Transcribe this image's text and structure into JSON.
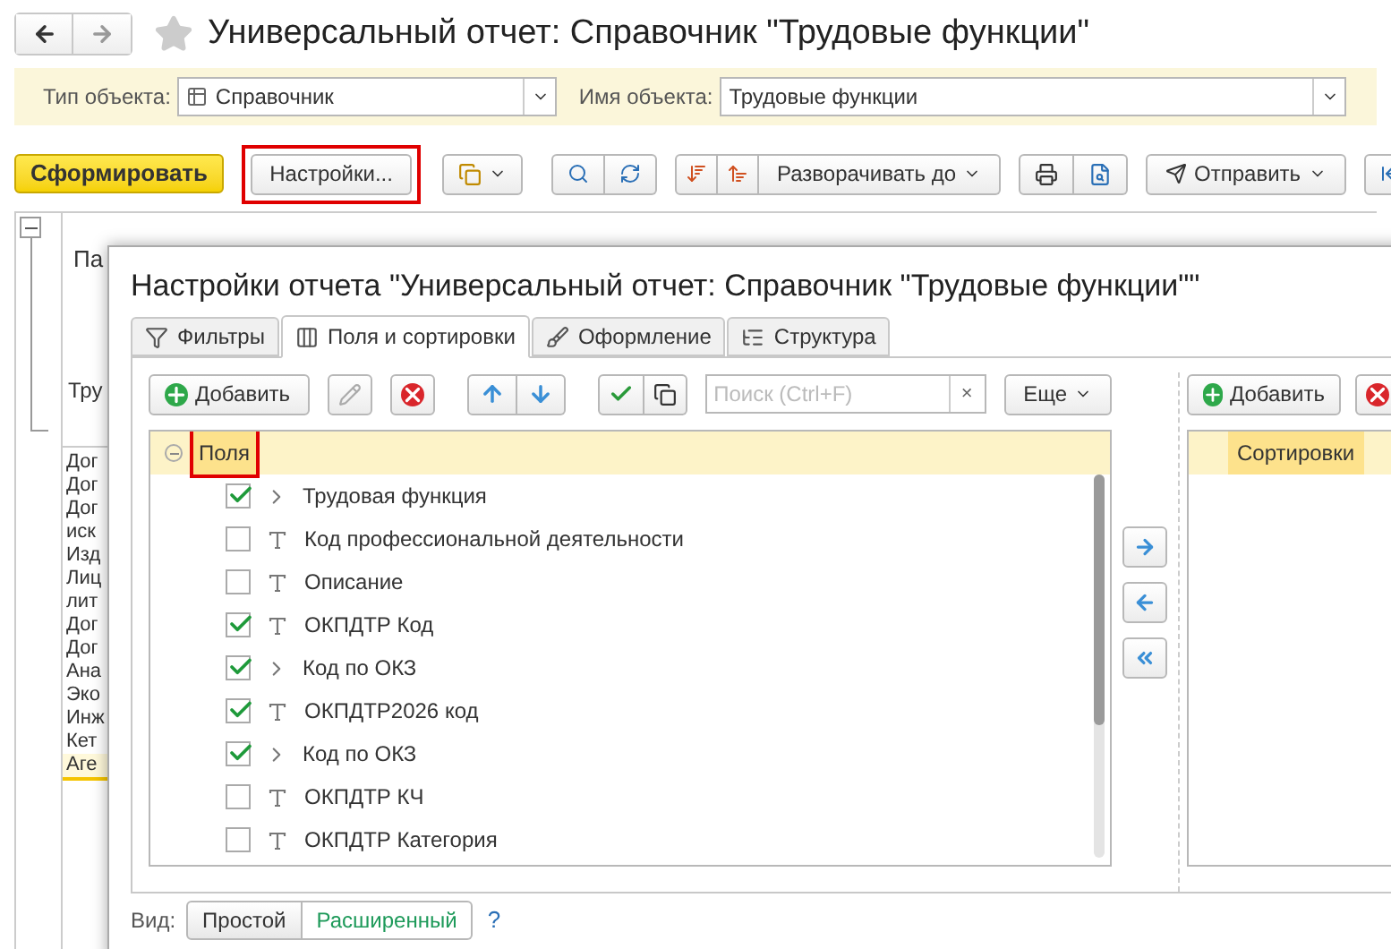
{
  "window": {
    "title": "Универсальный отчет: Справочник \"Трудовые функции\""
  },
  "filters": [
    {
      "label": "Тип объекта:",
      "value": "Справочник"
    },
    {
      "label": "Имя объекта:",
      "value": "Трудовые функции"
    }
  ],
  "toolbar": {
    "generate": "Сформировать",
    "settings": {
      "label": "Настройки...",
      "highlighted": true
    },
    "expand": "Разворачивать до",
    "send": "Отправить"
  },
  "report": {
    "header_fragment": "Па",
    "title_fragment": "Тру",
    "rows": [
      {
        "text": "Дог",
        "selected": false
      },
      {
        "text": "Дог",
        "selected": false
      },
      {
        "text": "Дог",
        "selected": false
      },
      {
        "text": "иск",
        "selected": false
      },
      {
        "text": "Изд",
        "selected": false
      },
      {
        "text": "Лиц",
        "selected": false
      },
      {
        "text": "лит",
        "selected": false
      },
      {
        "text": "Дог",
        "selected": false
      },
      {
        "text": "Дог",
        "selected": false
      },
      {
        "text": "Ана",
        "selected": false
      },
      {
        "text": "Эко",
        "selected": false
      },
      {
        "text": "Инж",
        "selected": false
      },
      {
        "text": "Кет",
        "selected": false
      },
      {
        "text": "Аге",
        "selected": true
      }
    ]
  },
  "dialog": {
    "title": "Настройки отчета \"Универсальный отчет: Справочник \"Трудовые функции\"\"",
    "tabs": [
      {
        "label": "Фильтры",
        "selected": false
      },
      {
        "label": "Поля и сортировки",
        "selected": true
      },
      {
        "label": "Оформление",
        "selected": false
      },
      {
        "label": "Структура",
        "selected": false
      }
    ],
    "add": "Добавить",
    "search_placeholder": "Поиск (Ctrl+F)",
    "search_clear": "×",
    "more": "Еще",
    "fields_root": {
      "label": "Поля",
      "highlighted": true
    },
    "fields": [
      {
        "label": "Трудовая функция",
        "checked": true,
        "kind": "group"
      },
      {
        "label": "Код профессиональной деятельности",
        "checked": false,
        "kind": "field"
      },
      {
        "label": "Описание",
        "checked": false,
        "kind": "field"
      },
      {
        "label": "ОКПДТР Код",
        "checked": true,
        "kind": "field"
      },
      {
        "label": "Код по ОКЗ",
        "checked": true,
        "kind": "group"
      },
      {
        "label": "ОКПДТР2026 код",
        "checked": true,
        "kind": "field"
      },
      {
        "label": "Код по ОКЗ",
        "checked": true,
        "kind": "group"
      },
      {
        "label": "ОКПДТР КЧ",
        "checked": false,
        "kind": "field"
      },
      {
        "label": "ОКПДТР Категория",
        "checked": false,
        "kind": "field"
      }
    ],
    "right_add": "Добавить",
    "sortings_header": "Сортировки",
    "view_label": "Вид:",
    "view_modes": [
      {
        "label": "Простой",
        "selected": false
      },
      {
        "label": "Расширенный",
        "selected": true
      }
    ],
    "help": "?"
  }
}
